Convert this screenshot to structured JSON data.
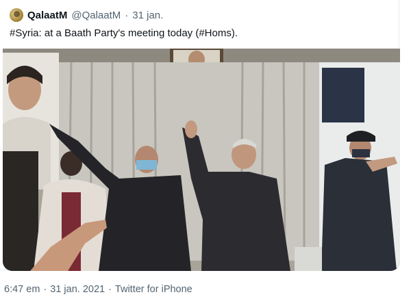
{
  "tweet": {
    "display_name": "QalaatM",
    "handle": "@QalaatM",
    "separator": "·",
    "date": "31 jan.",
    "text": "#Syria: at a Baath Party's meeting today (#Homs).",
    "image_icon": "photo"
  },
  "footer": {
    "time": "6:47 em",
    "dot1": "·",
    "date": "31 jan. 2021",
    "dot2": "·",
    "source": "Twitter for iPhone"
  },
  "colors": {
    "text_primary": "#0f1419",
    "text_secondary": "#536471",
    "border": "#e6ecf0"
  }
}
